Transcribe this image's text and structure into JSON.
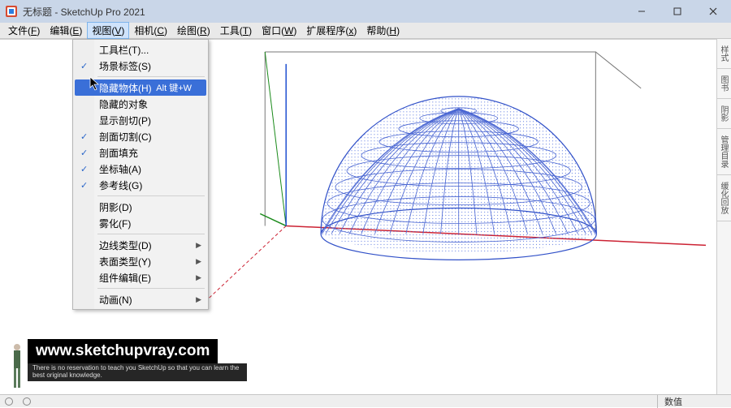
{
  "titlebar": {
    "title": "无标题 - SketchUp Pro 2021"
  },
  "menubar": {
    "items": [
      {
        "label": "文件",
        "key": "F"
      },
      {
        "label": "编辑",
        "key": "E"
      },
      {
        "label": "视图",
        "key": "V"
      },
      {
        "label": "相机",
        "key": "C"
      },
      {
        "label": "绘图",
        "key": "R"
      },
      {
        "label": "工具",
        "key": "T"
      },
      {
        "label": "窗口",
        "key": "W"
      },
      {
        "label": "扩展程序",
        "key": "x"
      },
      {
        "label": "帮助",
        "key": "H"
      }
    ],
    "open_index": 2
  },
  "dropdown": {
    "items": [
      {
        "type": "item",
        "label": "工具栏(T)...",
        "check": false
      },
      {
        "type": "item",
        "label": "场景标签(S)",
        "check": true
      },
      {
        "type": "sep"
      },
      {
        "type": "item",
        "label": "隐藏物体(H)",
        "shortcut": "Alt 键+W",
        "check": false,
        "highlight": true
      },
      {
        "type": "item",
        "label": "隐藏的对象",
        "check": false
      },
      {
        "type": "item",
        "label": "显示剖切(P)",
        "check": false
      },
      {
        "type": "item",
        "label": "剖面切割(C)",
        "check": true
      },
      {
        "type": "item",
        "label": "剖面填充",
        "check": true
      },
      {
        "type": "item",
        "label": "坐标轴(A)",
        "check": true
      },
      {
        "type": "item",
        "label": "参考线(G)",
        "check": true
      },
      {
        "type": "sep"
      },
      {
        "type": "item",
        "label": "阴影(D)",
        "check": false
      },
      {
        "type": "item",
        "label": "雾化(F)",
        "check": false
      },
      {
        "type": "sep"
      },
      {
        "type": "item",
        "label": "边线类型(D)",
        "submenu": true
      },
      {
        "type": "item",
        "label": "表面类型(Y)",
        "submenu": true
      },
      {
        "type": "item",
        "label": "组件编辑(E)",
        "submenu": true
      },
      {
        "type": "sep"
      },
      {
        "type": "item",
        "label": "动画(N)",
        "submenu": true
      }
    ]
  },
  "side_tabs": [
    "样式",
    "图书",
    "阴影",
    "管理目录",
    "缓化回放"
  ],
  "statusbar": {
    "value_label": "数值"
  },
  "watermark": {
    "url": "www.sketchupvray.com",
    "sub": "There is no reservation to teach you SketchUp so that you can learn the best original knowledge."
  }
}
